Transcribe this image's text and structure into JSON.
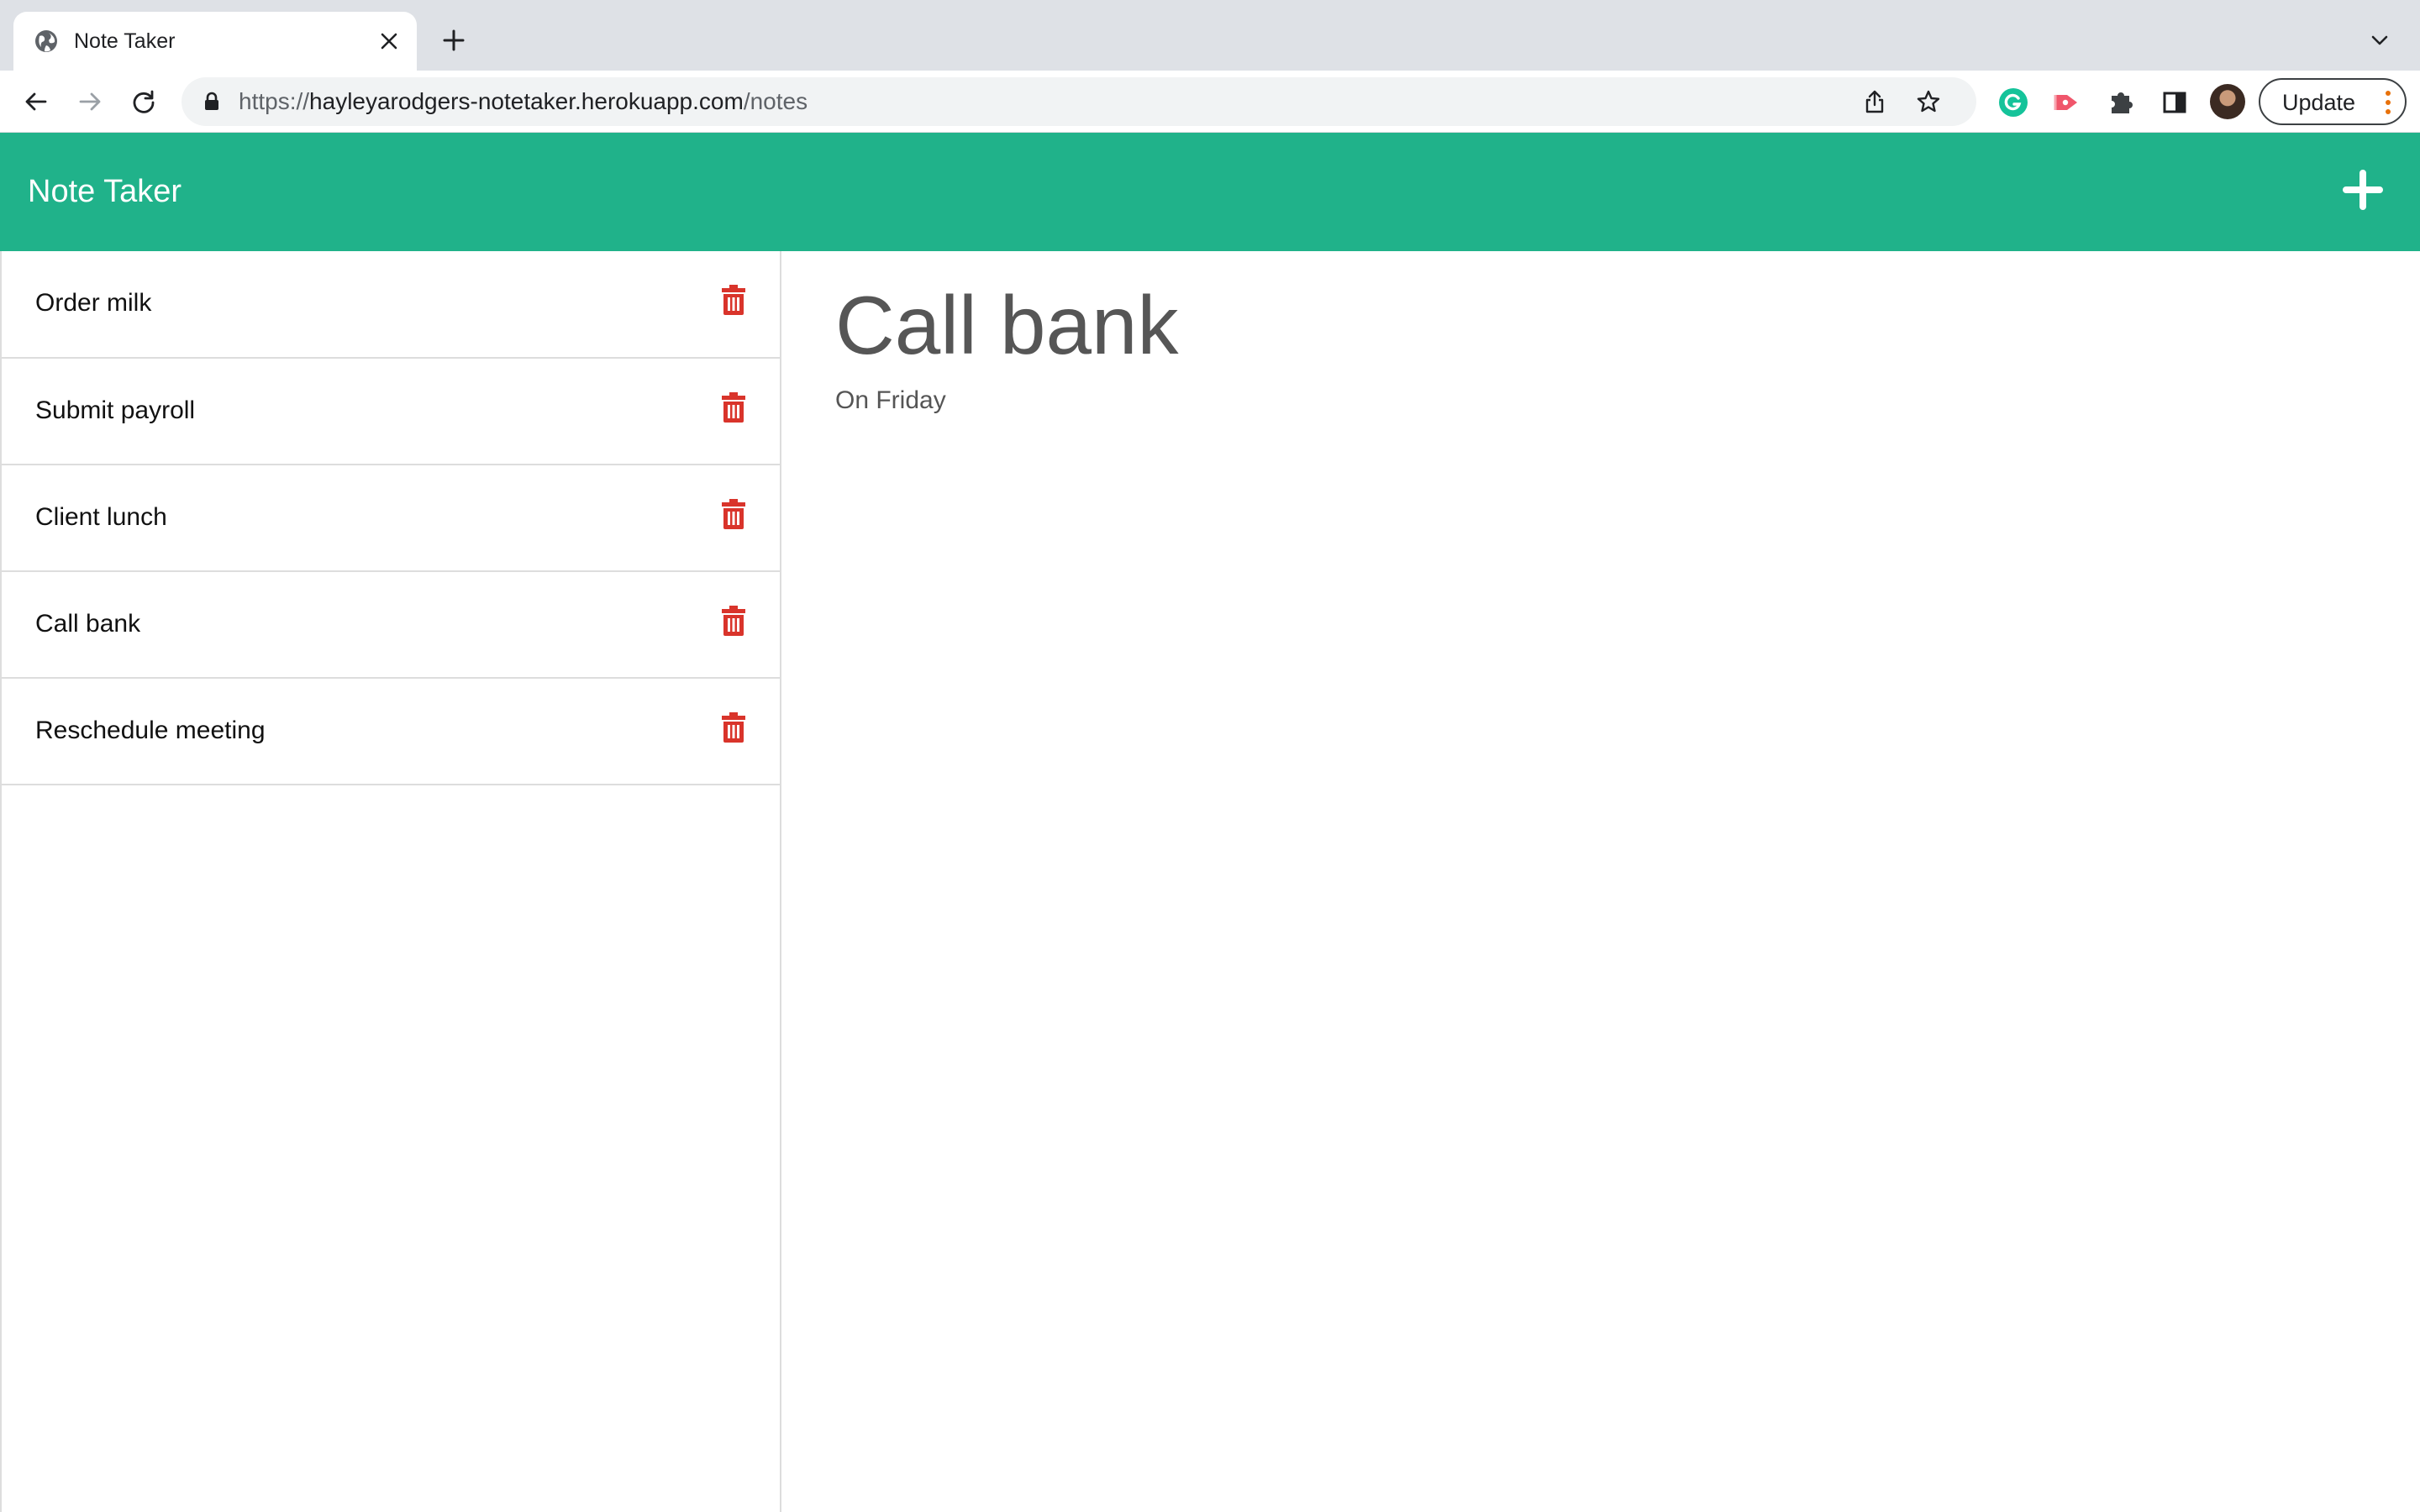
{
  "browser": {
    "tab_title": "Note Taker",
    "url_scheme": "https://",
    "url_host": "hayleyarodgers-notetaker.herokuapp.com",
    "url_path": "/notes",
    "update_label": "Update",
    "icons": {
      "favicon": "globe-icon",
      "close": "close-icon",
      "new_tab": "plus-icon",
      "tab_search": "chevron-down-icon",
      "back": "arrow-left-icon",
      "forward": "arrow-right-icon",
      "reload": "reload-icon",
      "lock": "lock-icon",
      "share": "share-icon",
      "bookmark": "star-icon",
      "grammarly": "grammarly-icon",
      "screencast": "screencast-icon",
      "extensions": "puzzle-icon",
      "side_panel": "side-panel-icon",
      "menu": "kebab-icon"
    }
  },
  "app": {
    "brand": "Note Taker",
    "colors": {
      "navbar": "#20b28a",
      "delete": "#d9342b",
      "heading": "#565656"
    },
    "notes": [
      {
        "title": "Order milk"
      },
      {
        "title": "Submit payroll"
      },
      {
        "title": "Client lunch"
      },
      {
        "title": "Call bank"
      },
      {
        "title": "Reschedule meeting"
      }
    ],
    "active_note": {
      "title": "Call bank",
      "text": "On Friday"
    }
  }
}
